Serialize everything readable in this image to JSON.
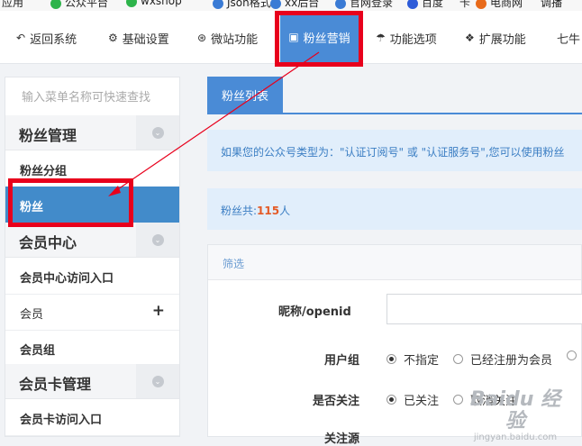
{
  "bookmarks": [
    "应用",
    "公众平台",
    "wxshop",
    "Json格式",
    "xx后台",
    "官网登录",
    "百度",
    "卡",
    "电商网",
    "调播"
  ],
  "topnav": {
    "items": [
      {
        "label": "返回系统",
        "icon": "back-icon"
      },
      {
        "label": "基础设置",
        "icon": "gear-icon"
      },
      {
        "label": "微站功能",
        "icon": "lifebuoy-icon"
      },
      {
        "label": "粉丝营销",
        "icon": "gift-icon",
        "active": true
      },
      {
        "label": "功能选项",
        "icon": "umbrella-icon"
      },
      {
        "label": "扩展功能",
        "icon": "cubes-icon"
      },
      {
        "label": "七牛",
        "icon": ""
      }
    ]
  },
  "sidebar": {
    "search_placeholder": "输入菜单名称可快速查找",
    "sections": [
      {
        "title": "粉丝管理",
        "items": [
          {
            "label": "粉丝分组"
          },
          {
            "label": "粉丝",
            "active": true
          }
        ]
      },
      {
        "title": "会员中心",
        "items": [
          {
            "label": "会员中心访问入口"
          },
          {
            "label": "会员",
            "has_add": true
          },
          {
            "label": "会员组"
          }
        ]
      },
      {
        "title": "会员卡管理",
        "items": [
          {
            "label": "会员卡访问入口"
          }
        ]
      }
    ]
  },
  "main": {
    "tab": "粉丝列表",
    "notice": "如果您的公众号类型为：\"认证订阅号\" 或 \"认证服务号\",您可以使用粉丝",
    "count": {
      "prefix": "粉丝共:",
      "value": "115",
      "suffix": "人"
    },
    "filter": {
      "title": "筛选",
      "fields": [
        {
          "label": "昵称/openid"
        },
        {
          "label": "用户组",
          "options": [
            "不指定",
            "已经注册为会员"
          ],
          "selected": 0
        },
        {
          "label": "是否关注",
          "options": [
            "已关注",
            "取消关注"
          ],
          "selected": 0
        },
        {
          "label": "关注源"
        }
      ]
    }
  },
  "watermark": {
    "line1": "Baidu 经验",
    "line2": "jingyan.baidu.com"
  },
  "colors": {
    "accent": "#4a8bd6",
    "highlight": "#e8001c",
    "notice_bg": "#e1eefb",
    "count_value": "#e45a26"
  }
}
